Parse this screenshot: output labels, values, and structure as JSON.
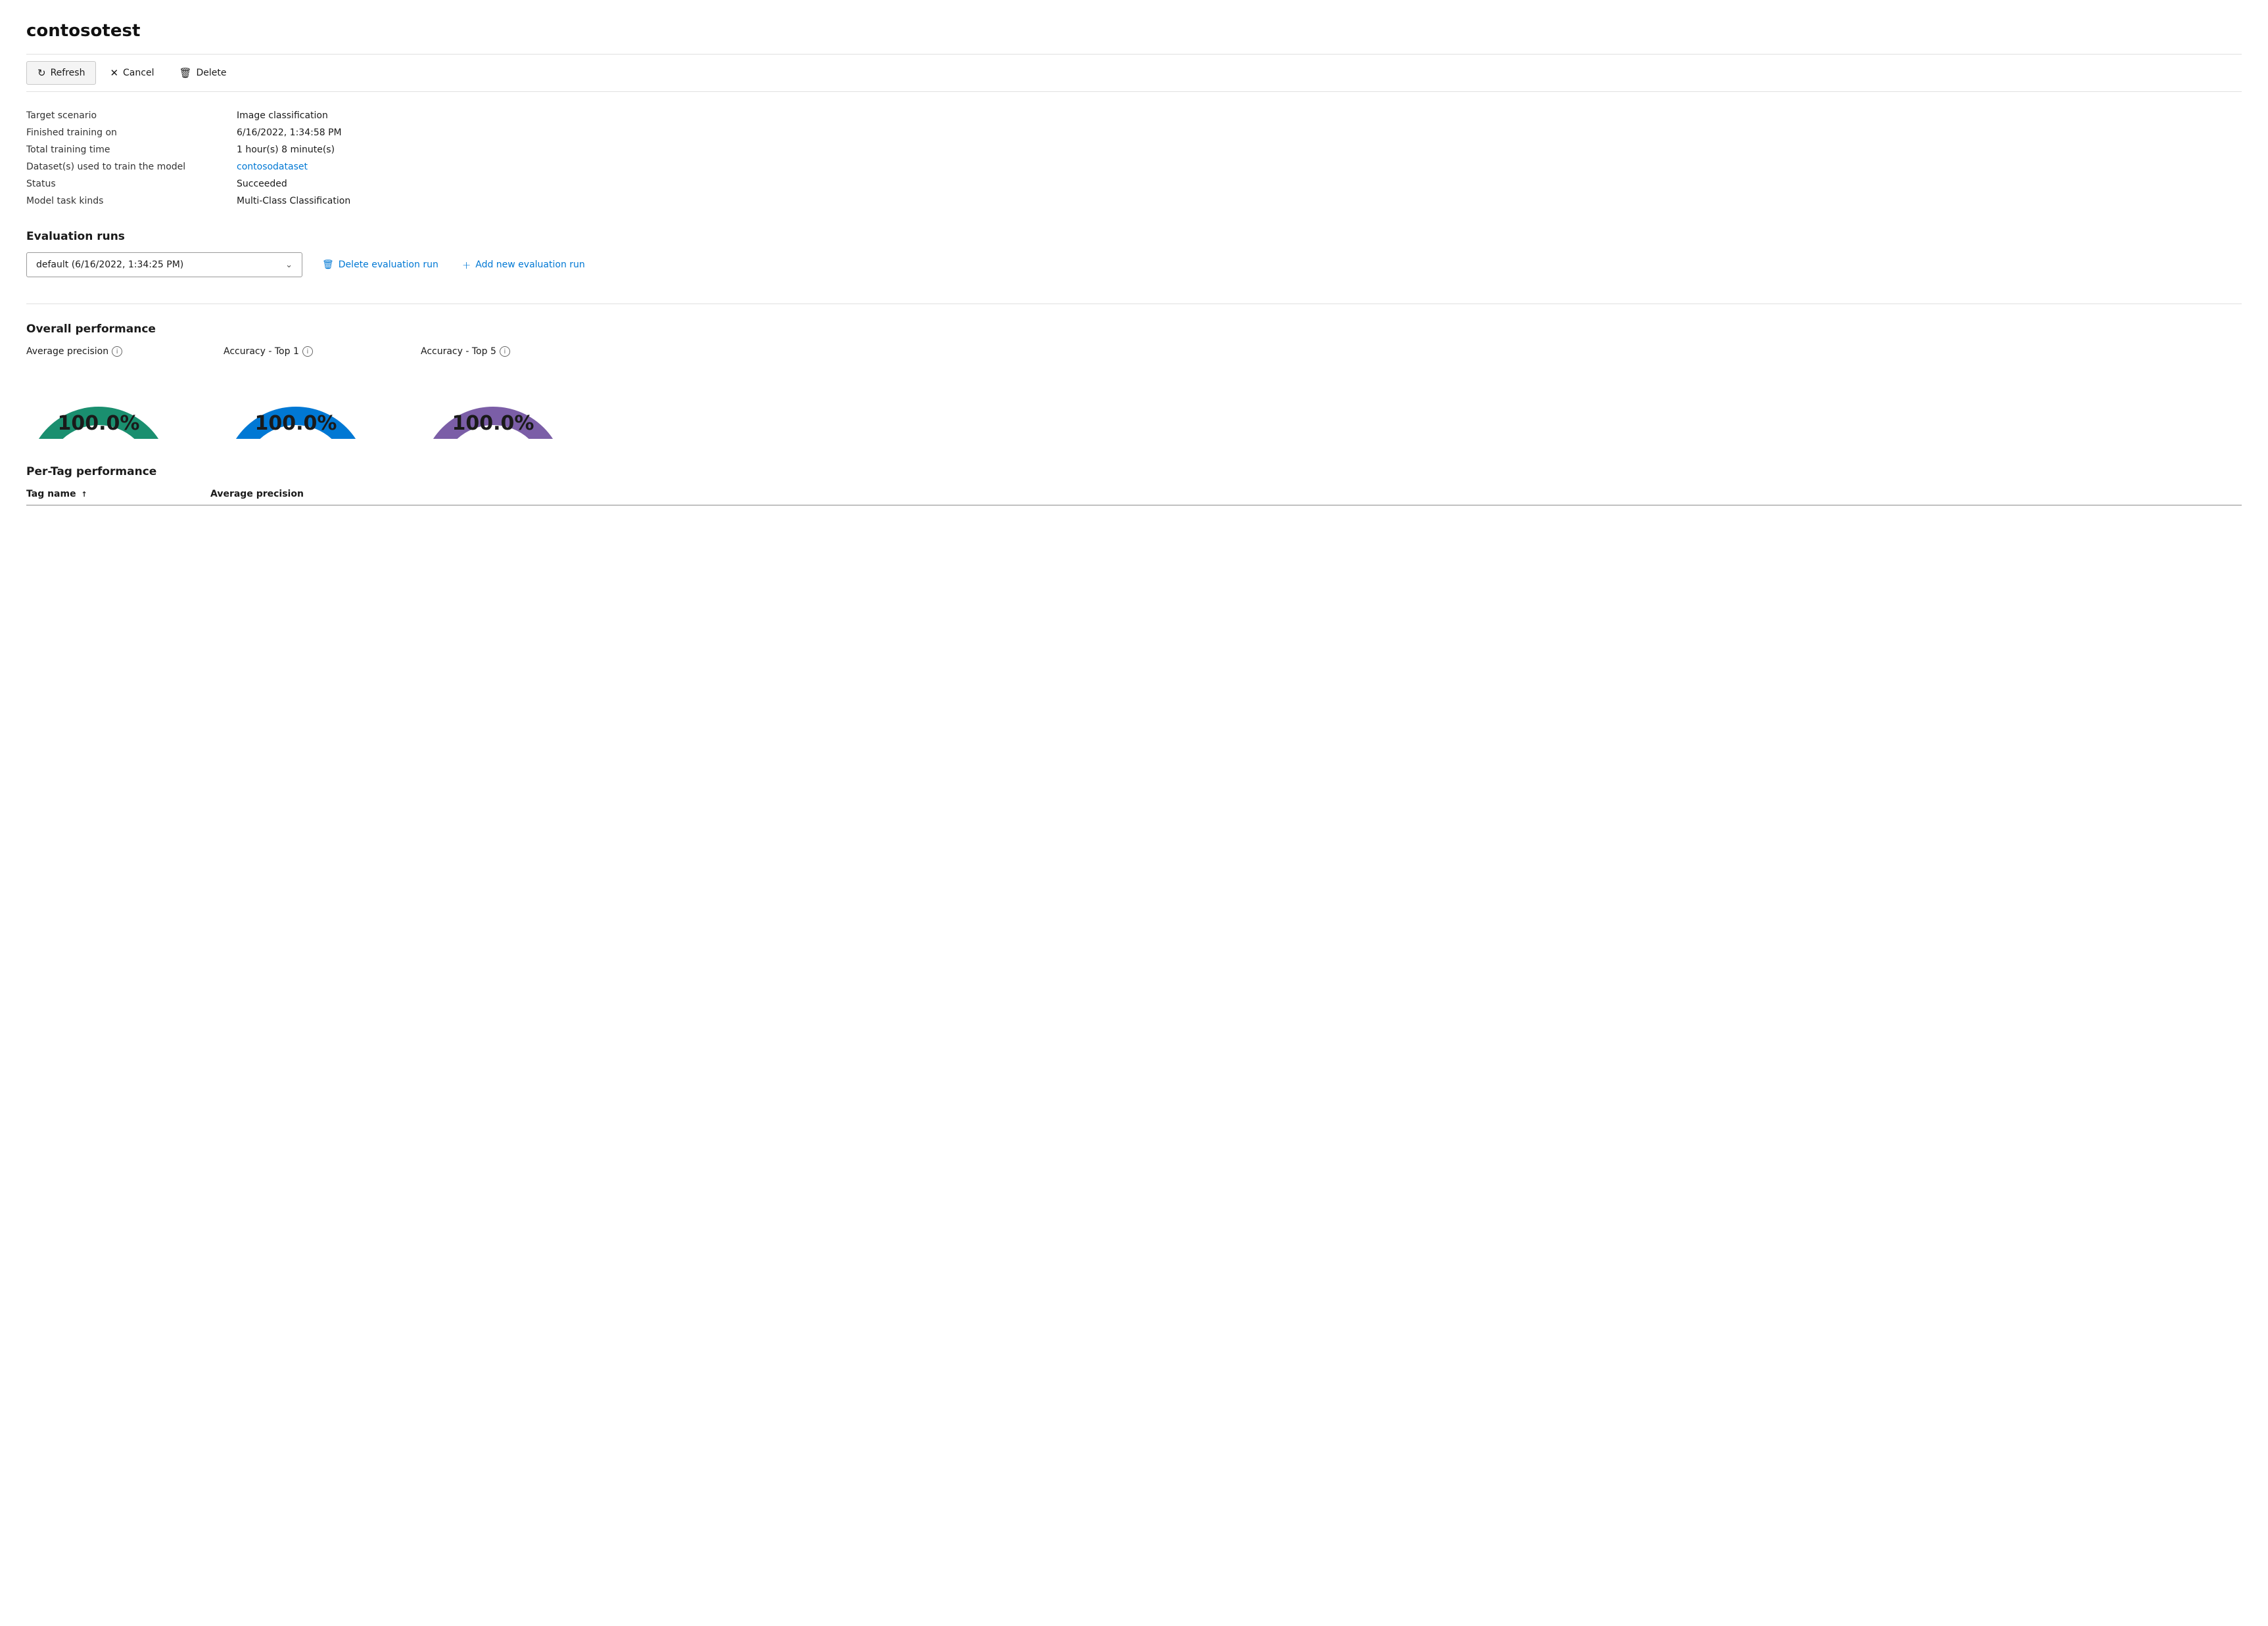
{
  "page": {
    "title": "contosotest"
  },
  "toolbar": {
    "refresh_label": "Refresh",
    "cancel_label": "Cancel",
    "delete_label": "Delete"
  },
  "info": {
    "target_scenario_label": "Target scenario",
    "target_scenario_value": "Image classification",
    "finished_training_label": "Finished training on",
    "finished_training_value": "6/16/2022, 1:34:58 PM",
    "total_training_label": "Total training time",
    "total_training_value": "1 hour(s) 8 minute(s)",
    "dataset_label": "Dataset(s) used to train the model",
    "dataset_value": "contosodataset",
    "status_label": "Status",
    "status_value": "Succeeded",
    "model_task_label": "Model task kinds",
    "model_task_value": "Multi-Class Classification"
  },
  "evaluation_runs": {
    "section_title": "Evaluation runs",
    "selected_run": "default (6/16/2022, 1:34:25 PM)",
    "delete_btn": "Delete evaluation run",
    "add_btn": "Add new evaluation run"
  },
  "overall_performance": {
    "section_title": "Overall performance",
    "gauges": [
      {
        "label": "Average precision",
        "value": "100.0%",
        "color": "#1a8f6f"
      },
      {
        "label": "Accuracy - Top 1",
        "value": "100.0%",
        "color": "#0078d4"
      },
      {
        "label": "Accuracy - Top 5",
        "value": "100.0%",
        "color": "#7b5ea7"
      }
    ]
  },
  "per_tag_performance": {
    "section_title": "Per-Tag performance",
    "columns": [
      {
        "label": "Tag name",
        "sort": "asc"
      },
      {
        "label": "Average precision"
      }
    ]
  }
}
